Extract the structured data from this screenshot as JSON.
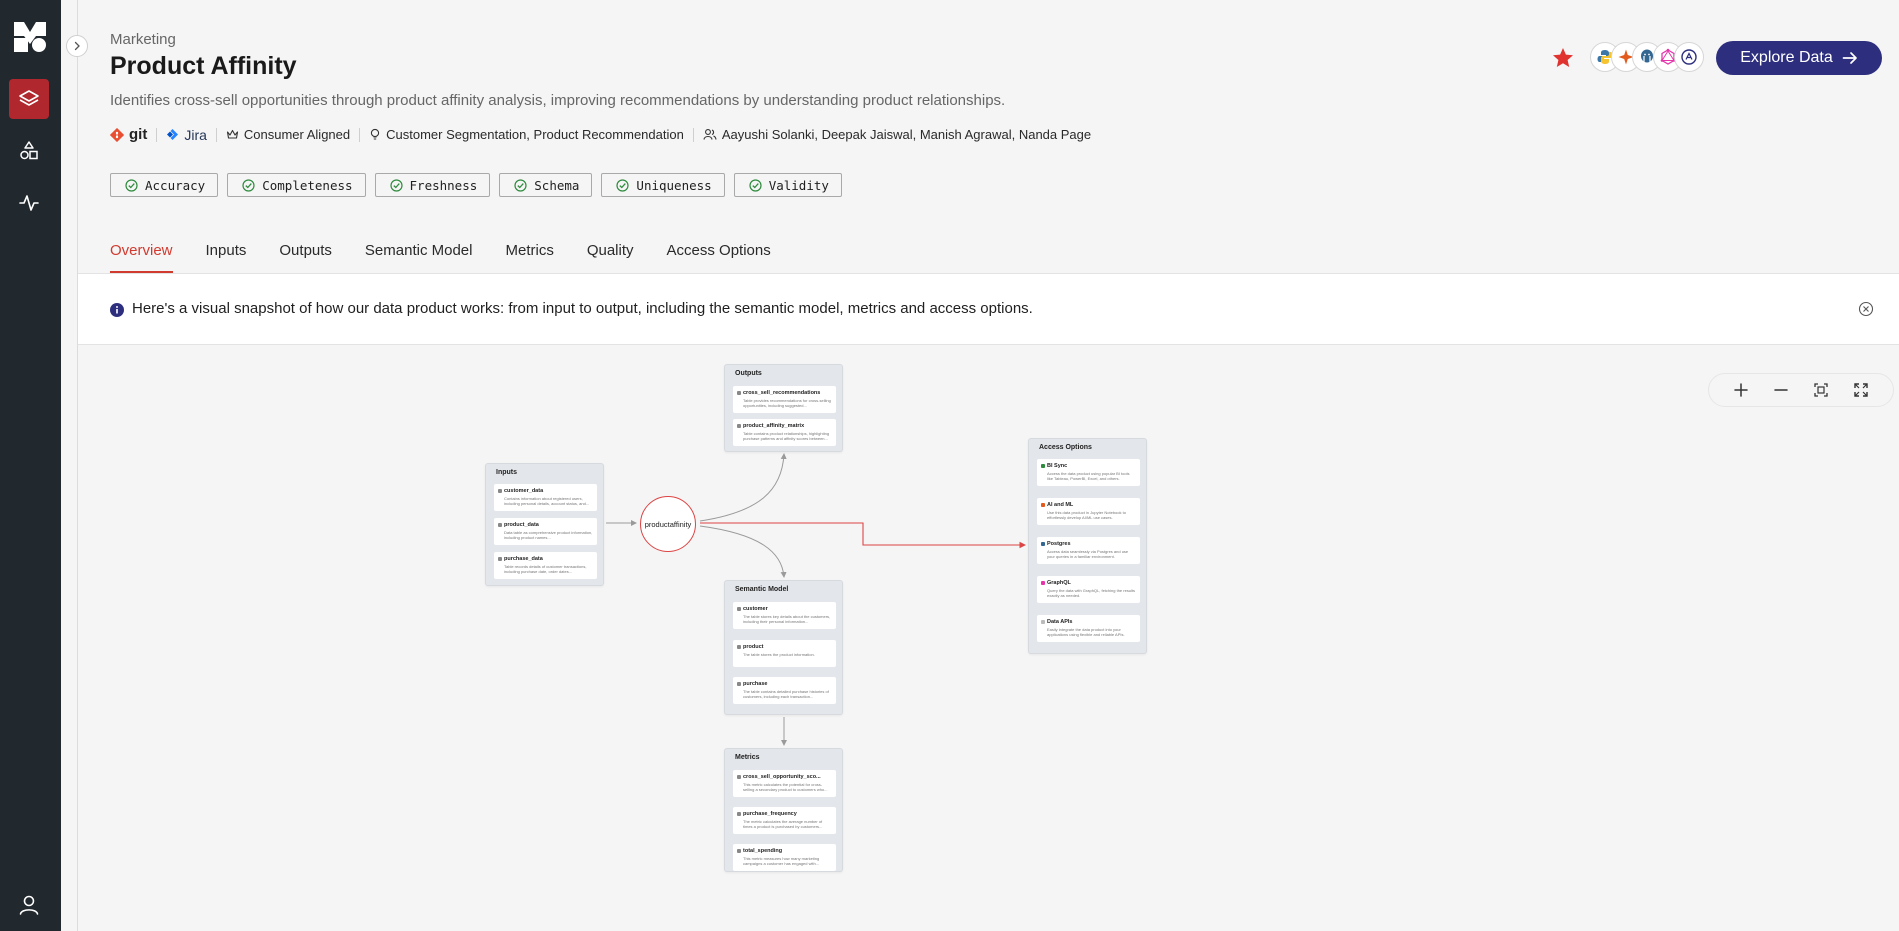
{
  "header": {
    "breadcrumb": "Marketing",
    "title": "Product Affinity",
    "description": "Identifies cross-sell opportunities through product affinity analysis, improving recommendations by understanding product relationships.",
    "explore_label": "Explore Data"
  },
  "meta": {
    "git_label": "git",
    "jira_label": "Jira",
    "alignment": "Consumer Aligned",
    "use_cases": "Customer Segmentation, Product Recommendation",
    "owners": "Aayushi Solanki, Deepak Jaiswal, Manish Agrawal, Nanda Page"
  },
  "quality": [
    "Accuracy",
    "Completeness",
    "Freshness",
    "Schema",
    "Uniqueness",
    "Validity"
  ],
  "tabs": [
    "Overview",
    "Inputs",
    "Outputs",
    "Semantic Model",
    "Metrics",
    "Quality",
    "Access Options"
  ],
  "tools": [
    "Python",
    "Spark",
    "PostgreSQL",
    "GraphQL",
    "Data API"
  ],
  "banner": {
    "text": "Here's a visual snapshot of how our data product works: from input to output, including the semantic model, metrics and access options."
  },
  "lineage": {
    "center": "productaffinity",
    "inputs": {
      "title": "Inputs",
      "items": [
        {
          "name": "customer_data",
          "desc": "Contains information about registered users, including personal details, account status, and..."
        },
        {
          "name": "product_data",
          "desc": "Data table as comprehensive product information, including product names..."
        },
        {
          "name": "purchase_data",
          "desc": "Table records details of customer transactions, including purchase date, order dates..."
        }
      ]
    },
    "outputs": {
      "title": "Outputs",
      "items": [
        {
          "name": "cross_sell_recommendations",
          "desc": "Table provides recommendations for cross-selling opportunities, including suggested..."
        },
        {
          "name": "product_affinity_matrix",
          "desc": "Table contains product relationships, highlighting purchase patterns and affinity scores between..."
        }
      ]
    },
    "semantic": {
      "title": "Semantic Model",
      "items": [
        {
          "name": "customer",
          "desc": "The table stores key details about the customers, including their personal information..."
        },
        {
          "name": "product",
          "desc": "The table stores the product information."
        },
        {
          "name": "purchase",
          "desc": "The table contains detailed purchase histories of customers, including each transaction..."
        }
      ]
    },
    "metrics": {
      "title": "Metrics",
      "items": [
        {
          "name": "cross_sell_opportunity_sco...",
          "desc": "This metric calculates the potential for cross-selling a secondary product to customers who..."
        },
        {
          "name": "purchase_frequency",
          "desc": "The metric calculates the average number of times a product is purchased by customers..."
        },
        {
          "name": "total_spending",
          "desc": "This metric measures how many marketing campaigns a customer has engaged with..."
        }
      ]
    },
    "access": {
      "title": "Access Options",
      "items": [
        {
          "name": "BI Sync",
          "desc": "Access the data product using popular BI tools like Tableau, PowerBI, Excel, and others."
        },
        {
          "name": "AI and ML",
          "desc": "Use this data product in Jupyter Notebook to effortlessly develop AI/ML use cases."
        },
        {
          "name": "Postgres",
          "desc": "Access data seamlessly via Postgres and use your queries in a familiar environment."
        },
        {
          "name": "GraphQL",
          "desc": "Query the data with GraphQL, fetching the results exactly as needed."
        },
        {
          "name": "Data APIs",
          "desc": "Easily integrate the data product into your applications using flexible and reliable APIs."
        }
      ]
    }
  },
  "colors": {
    "rail": "#21292e",
    "rail_active": "#b0272e",
    "accent": "#d13a2f",
    "primary_button": "#2d2f7e"
  }
}
